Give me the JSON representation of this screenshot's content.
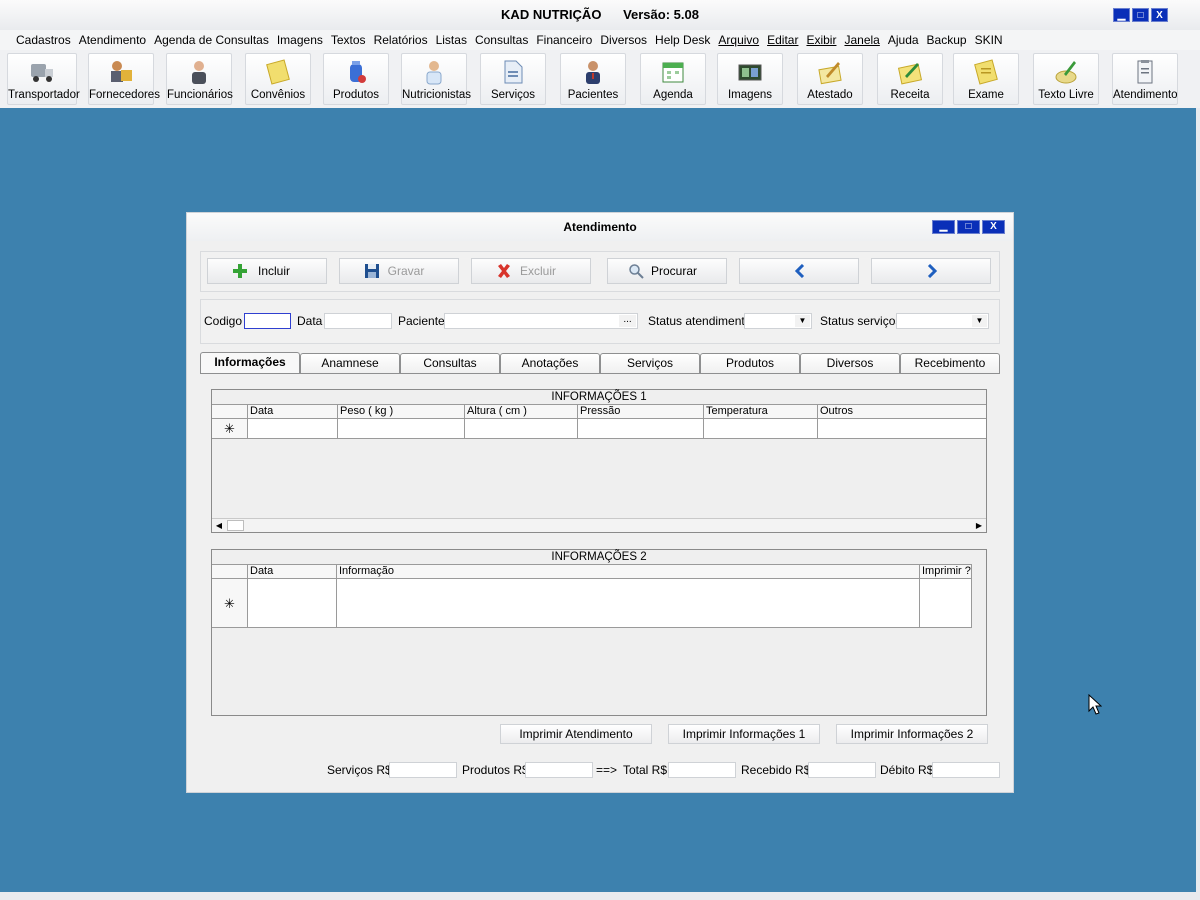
{
  "app": {
    "name": "KAD NUTRIÇÃO",
    "version": "Versão: 5.08"
  },
  "window_controls": {
    "minimize": "▁",
    "maximize": "□",
    "close": "X"
  },
  "menu": [
    "Cadastros",
    "Atendimento",
    "Agenda de Consultas",
    "Imagens",
    "Textos",
    "Relatórios",
    "Listas",
    "Consultas",
    "Financeiro",
    "Diversos",
    "Help Desk",
    "Arquivo",
    "Editar",
    "Exibir",
    "Janela",
    "Ajuda",
    "Backup",
    "SKIN"
  ],
  "toolbar": [
    {
      "label": "Transportador",
      "icon": "truck-icon"
    },
    {
      "label": "Fornecedores",
      "icon": "suppliers-icon"
    },
    {
      "label": "Funcionários",
      "icon": "employee-icon"
    },
    {
      "label": "Convênios",
      "icon": "notes-icon"
    },
    {
      "label": "Produtos",
      "icon": "medicine-bottle-icon"
    },
    {
      "label": "Nutricionistas",
      "icon": "nutritionist-icon"
    },
    {
      "label": "Serviços",
      "icon": "document-icon"
    },
    {
      "label": "Pacientes",
      "icon": "patient-icon"
    },
    {
      "label": "Agenda",
      "icon": "calendar-icon"
    },
    {
      "label": "Imagens",
      "icon": "images-icon"
    },
    {
      "label": "Atestado",
      "icon": "certificate-pen-icon"
    },
    {
      "label": "Receita",
      "icon": "prescription-pen-icon"
    },
    {
      "label": "Exame",
      "icon": "exam-notes-icon"
    },
    {
      "label": "Texto Livre",
      "icon": "free-text-icon"
    },
    {
      "label": "Atendimento",
      "icon": "clipboard-icon"
    }
  ],
  "dialog": {
    "title": "Atendimento",
    "actions": {
      "include": "Incluir",
      "save": "Gravar",
      "delete": "Excluir",
      "search": "Procurar",
      "prev": "‹",
      "next": "›"
    },
    "filters": {
      "code_label": "Codigo",
      "date_label": "Data",
      "patient_label": "Paciente",
      "patient_lookup": "...",
      "status_att_label": "Status atendimento",
      "status_serv_label": "Status serviços"
    },
    "tabs": [
      "Informações",
      "Anamnese",
      "Consultas",
      "Anotações",
      "Serviços",
      "Produtos",
      "Diversos",
      "Recebimento"
    ],
    "grid1": {
      "caption": "INFORMAÇÕES 1",
      "columns": [
        "Data",
        "Peso ( kg )",
        "Altura ( cm )",
        "Pressão",
        "Temperatura",
        "Outros"
      ],
      "new_row_marker": "✳"
    },
    "grid2": {
      "caption": "INFORMAÇÕES 2",
      "columns": [
        "Data",
        "Informação",
        "Imprimir ?"
      ],
      "new_row_marker": "✳"
    },
    "print_buttons": [
      "Imprimir Atendimento",
      "Imprimir Informações 1",
      "Imprimir Informações 2"
    ],
    "totals": {
      "services": "Serviços R$",
      "products": "Produtos R$",
      "arrow": "==>",
      "total": "Total R$",
      "received": "Recebido R$",
      "debit": "Débito R$"
    }
  },
  "colors": {
    "desktop": "#3d81ae",
    "title_controls": "#0a2fb8",
    "code_focus_border": "#2f3fd0"
  }
}
